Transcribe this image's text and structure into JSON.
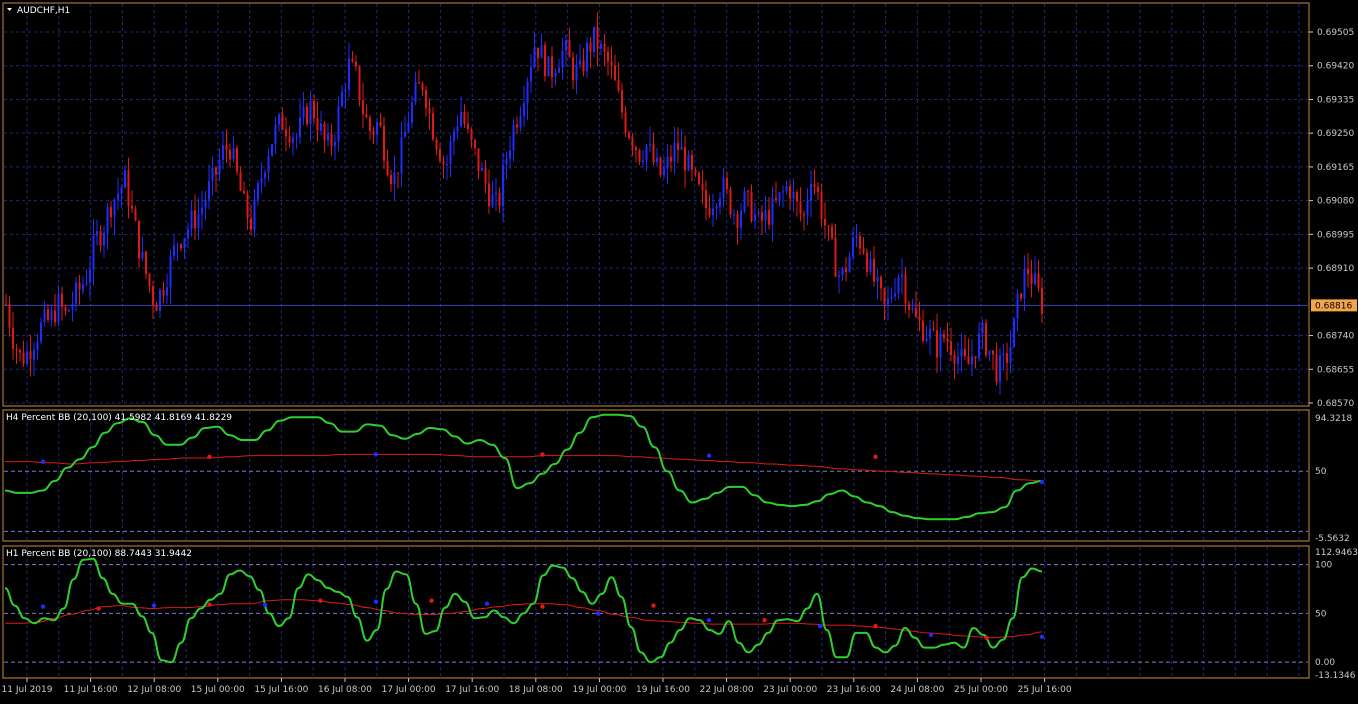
{
  "symbol": "AUDCHF,H1",
  "current_price": "0.68816",
  "colors": {
    "background": "#000000",
    "frame": "#c88b3c",
    "grid": "#1e2a78",
    "axis_text": "#c8c8c8",
    "bull": "#1f2cff",
    "bear": "#e01818",
    "indicator_main": "#2fcf2f",
    "indicator_signal": "#e01818",
    "dot_up": "#1f2cff",
    "dot_down": "#e01818",
    "level": "#7b7bd0",
    "price_tag_bg": "#f3a54a"
  },
  "panes": {
    "h4": {
      "label": "H4 Percent BB (20,100) 41.5982 41.8169 41.8229"
    },
    "h1": {
      "label": "H1 Percent BB (20,100) 88.7443 31.9442"
    }
  },
  "chart_data": [
    {
      "type": "candlestick",
      "title": "AUDCHF,H1",
      "y_ticks": [
        "0.69505",
        "0.69420",
        "0.69335",
        "0.69250",
        "0.69165",
        "0.69080",
        "0.68995",
        "0.68910",
        "0.68740",
        "0.68655",
        "0.68570"
      ],
      "ylim": [
        0.6855,
        0.6953
      ],
      "last_price": 0.68816,
      "x_ticks": [
        "11 Jul 2019",
        "11 Jul 16:00",
        "12 Jul 08:00",
        "15 Jul 00:00",
        "15 Jul 16:00",
        "16 Jul 08:00",
        "17 Jul 00:00",
        "17 Jul 16:00",
        "18 Jul 08:00",
        "19 Jul 00:00",
        "19 Jul 16:00",
        "22 Jul 08:00",
        "23 Jul 00:00",
        "23 Jul 16:00",
        "24 Jul 08:00",
        "25 Jul 00:00",
        "25 Jul 16:00"
      ],
      "close_path": [
        0.6882,
        0.6873,
        0.6868,
        0.687,
        0.6874,
        0.6877,
        0.6878,
        0.6882,
        0.6879,
        0.6883,
        0.6886,
        0.689,
        0.6898,
        0.6901,
        0.6907,
        0.691,
        0.6913,
        0.6904,
        0.6895,
        0.6888,
        0.6882,
        0.6886,
        0.6892,
        0.6898,
        0.69,
        0.6903,
        0.6905,
        0.691,
        0.6914,
        0.692,
        0.6922,
        0.6914,
        0.6906,
        0.6902,
        0.6912,
        0.692,
        0.6925,
        0.6928,
        0.6926,
        0.6924,
        0.6929,
        0.6932,
        0.6927,
        0.6921,
        0.6924,
        0.6934,
        0.6942,
        0.6939,
        0.693,
        0.6925,
        0.6928,
        0.6919,
        0.6913,
        0.692,
        0.6929,
        0.6935,
        0.6938,
        0.6928,
        0.6922,
        0.6916,
        0.6925,
        0.6931,
        0.6924,
        0.6919,
        0.6914,
        0.6909,
        0.6906,
        0.6918,
        0.6926,
        0.6932,
        0.694,
        0.6948,
        0.6944,
        0.694,
        0.6944,
        0.6946,
        0.6941,
        0.694,
        0.6946,
        0.6949,
        0.6945,
        0.6942,
        0.6935,
        0.6928,
        0.6924,
        0.692,
        0.6922,
        0.6917,
        0.6914,
        0.6918,
        0.6922,
        0.6919,
        0.6914,
        0.691,
        0.6906,
        0.6909,
        0.6912,
        0.6908,
        0.6904,
        0.6908,
        0.6906,
        0.6902,
        0.6904,
        0.6906,
        0.6909,
        0.6912,
        0.6907,
        0.6903,
        0.6915,
        0.6909,
        0.6901,
        0.6894,
        0.6888,
        0.6893,
        0.6899,
        0.6897,
        0.689,
        0.6885,
        0.688,
        0.6886,
        0.6891,
        0.6883,
        0.6878,
        0.6876,
        0.6874,
        0.6871,
        0.6874,
        0.6871,
        0.6868,
        0.6866,
        0.6871,
        0.6874,
        0.687,
        0.6865,
        0.6867,
        0.6873,
        0.6885,
        0.6891,
        0.6887,
        0.6882
      ]
    },
    {
      "type": "line",
      "title": "H4 Percent BB (20,100) 41.5982 41.8169 41.8229",
      "y_ticks": [
        "94.3218",
        "50",
        "-5.5632"
      ],
      "ylim": [
        -5.5632,
        94.3218
      ],
      "series": [
        {
          "values": [
            34,
            32,
            32,
            34,
            42,
            53,
            60,
            70,
            82,
            90,
            94,
            91,
            80,
            72,
            72,
            78,
            86,
            87,
            80,
            76,
            76,
            84,
            92,
            95,
            95,
            95,
            90,
            83,
            83,
            89,
            88,
            80,
            77,
            81,
            86,
            85,
            79,
            73,
            76,
            72,
            61,
            36,
            40,
            48,
            56,
            68,
            82,
            95,
            97,
            97,
            96,
            87,
            70,
            50,
            34,
            24,
            27,
            32,
            37,
            37,
            30,
            24,
            22,
            21,
            22,
            25,
            31,
            34,
            29,
            24,
            21,
            16,
            13,
            11,
            10,
            10,
            10,
            12,
            15,
            16,
            20,
            34,
            40,
            42
          ]
        },
        {
          "values": [
            58,
            58,
            57,
            56,
            57,
            58,
            59,
            60,
            61,
            61,
            62,
            63,
            63,
            63,
            63,
            64,
            64,
            64,
            64,
            64,
            63,
            62,
            62,
            62,
            63,
            63,
            63,
            63,
            62,
            61,
            60,
            59,
            58,
            57,
            56,
            55,
            54,
            52,
            51,
            50,
            49,
            48,
            47,
            46,
            45,
            43,
            42
          ]
        },
        {
          "values": [
            58,
            62,
            64,
            64,
            63,
            62,
            41
          ]
        }
      ]
    },
    {
      "type": "line",
      "title": "H1 Percent BB (20,100) 88.7443 31.9442",
      "y_ticks": [
        "112.9463",
        "100",
        "50",
        "0.00",
        "-13.1346"
      ],
      "ylim": [
        -13.1346,
        112.9463
      ],
      "series": [
        {
          "values": [
            76,
            58,
            45,
            40,
            45,
            43,
            55,
            85,
            105,
            106,
            86,
            70,
            60,
            60,
            47,
            30,
            2,
            0,
            20,
            45,
            55,
            64,
            70,
            90,
            94,
            88,
            74,
            50,
            37,
            45,
            76,
            90,
            84,
            76,
            72,
            67,
            46,
            22,
            33,
            75,
            93,
            90,
            60,
            29,
            32,
            56,
            70,
            62,
            45,
            46,
            53,
            46,
            40,
            50,
            60,
            89,
            99,
            97,
            86,
            72,
            60,
            70,
            87,
            67,
            36,
            10,
            0,
            5,
            20,
            33,
            45,
            43,
            33,
            29,
            42,
            20,
            10,
            18,
            30,
            43,
            44,
            42,
            55,
            70,
            33,
            5,
            5,
            30,
            30,
            15,
            10,
            17,
            35,
            25,
            15,
            15,
            18,
            20,
            15,
            35,
            28,
            15,
            23,
            45,
            87,
            96,
            93
          ]
        },
        {
          "values": [
            40,
            40,
            41,
            45,
            49,
            53,
            57,
            58,
            56,
            55,
            56,
            56,
            57,
            59,
            60,
            60,
            63,
            64,
            64,
            63,
            61,
            59,
            56,
            53,
            50,
            49,
            49,
            50,
            52,
            55,
            57,
            59,
            60,
            60,
            59,
            56,
            53,
            49,
            46,
            43,
            42,
            41,
            40,
            39,
            39,
            39,
            39,
            40,
            40,
            39,
            38,
            38,
            37,
            36,
            34,
            32,
            30,
            29,
            27,
            26,
            25,
            26,
            28,
            31
          ]
        },
        {
          "values": [
            57,
            55,
            58,
            59,
            59,
            63,
            62,
            63,
            60,
            57,
            50,
            58,
            43,
            43,
            37,
            37,
            28,
            25,
            26
          ]
        }
      ]
    }
  ]
}
